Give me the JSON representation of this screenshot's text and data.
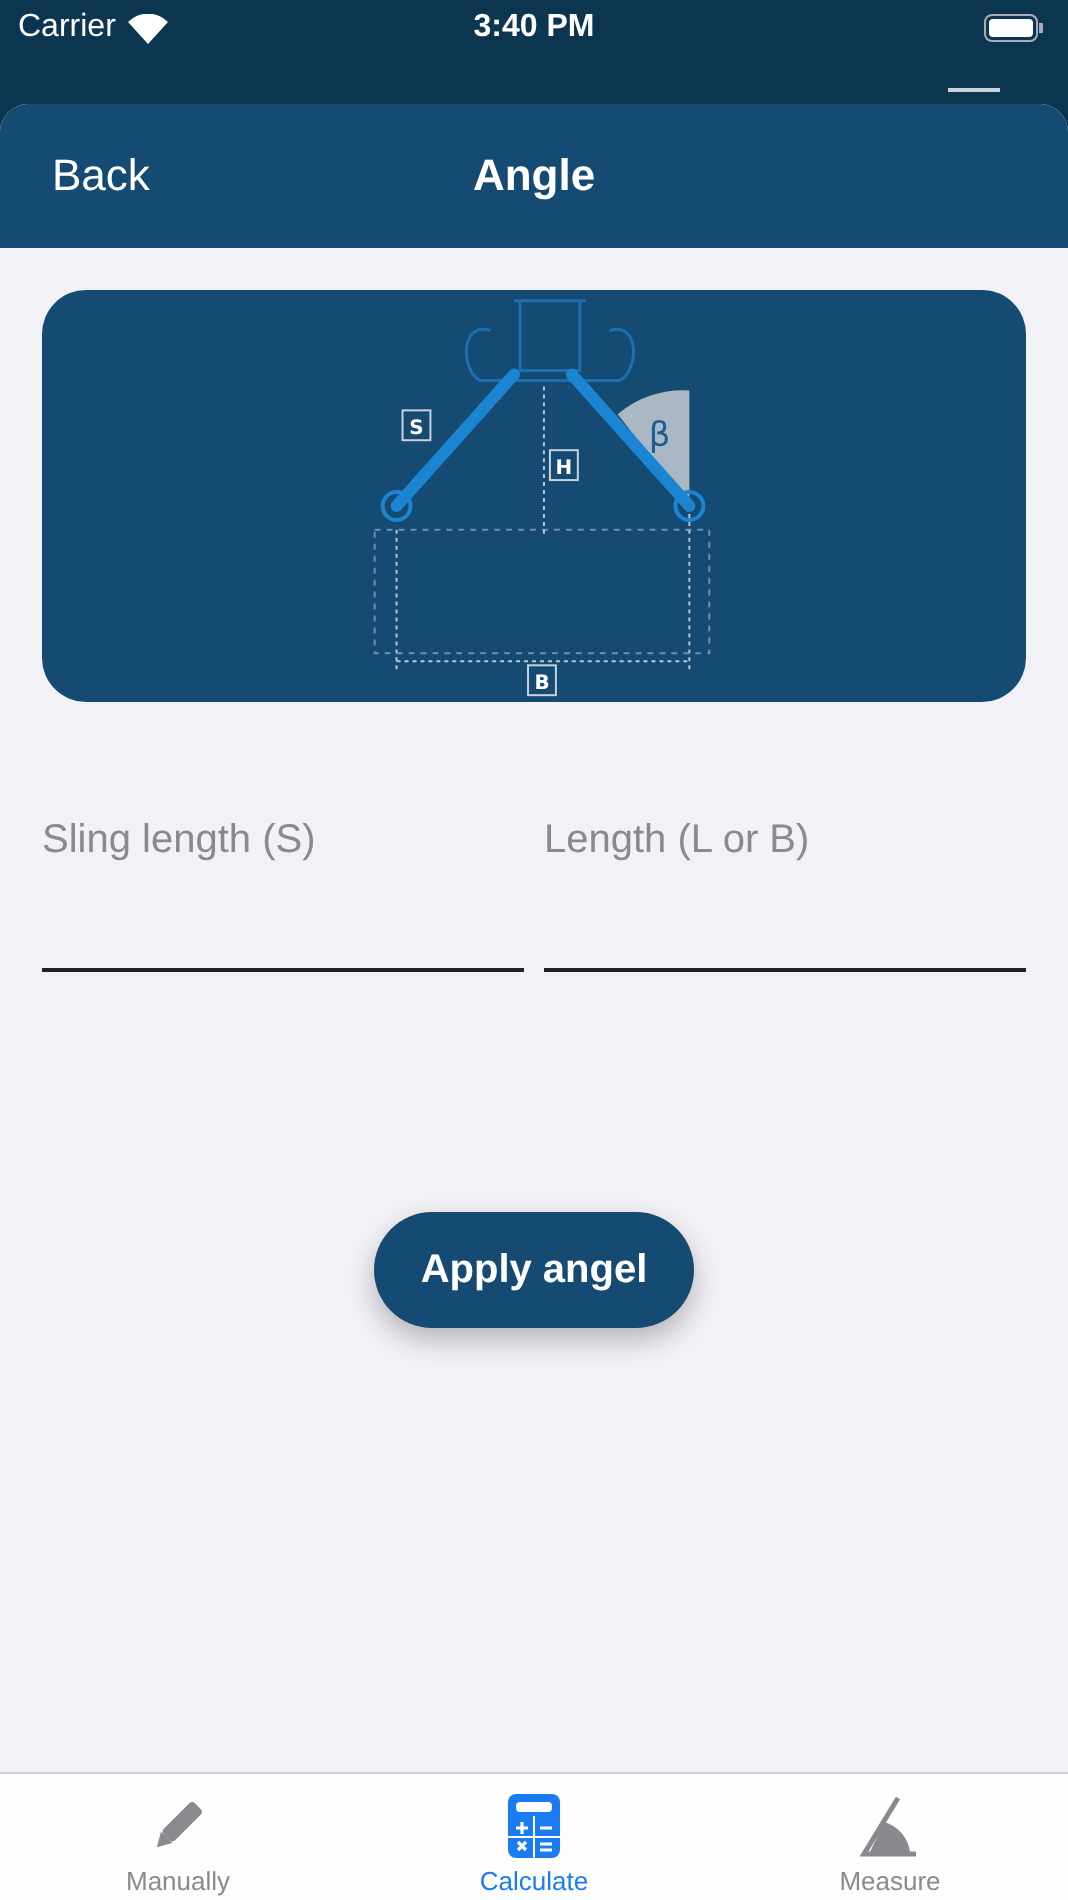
{
  "status_bar": {
    "carrier": "Carrier",
    "time": "3:40 PM"
  },
  "nav": {
    "back": "Back",
    "title": "Angle"
  },
  "diagram": {
    "labels": [
      {
        "kind": "s",
        "text": "S"
      },
      {
        "kind": "h",
        "text": "H"
      },
      {
        "kind": "b",
        "text": "B"
      },
      {
        "kind": "beta",
        "text": "β"
      }
    ]
  },
  "fields": [
    {
      "placeholder": "Sling length (S)"
    },
    {
      "placeholder": "Length (L or B)"
    }
  ],
  "apply_button": "Apply angel",
  "tabs": [
    {
      "label": "Manually",
      "kind": "pencil",
      "selected": false
    },
    {
      "label": "Calculate",
      "kind": "calculator",
      "selected": true
    },
    {
      "label": "Measure",
      "kind": "angle",
      "selected": false
    }
  ]
}
